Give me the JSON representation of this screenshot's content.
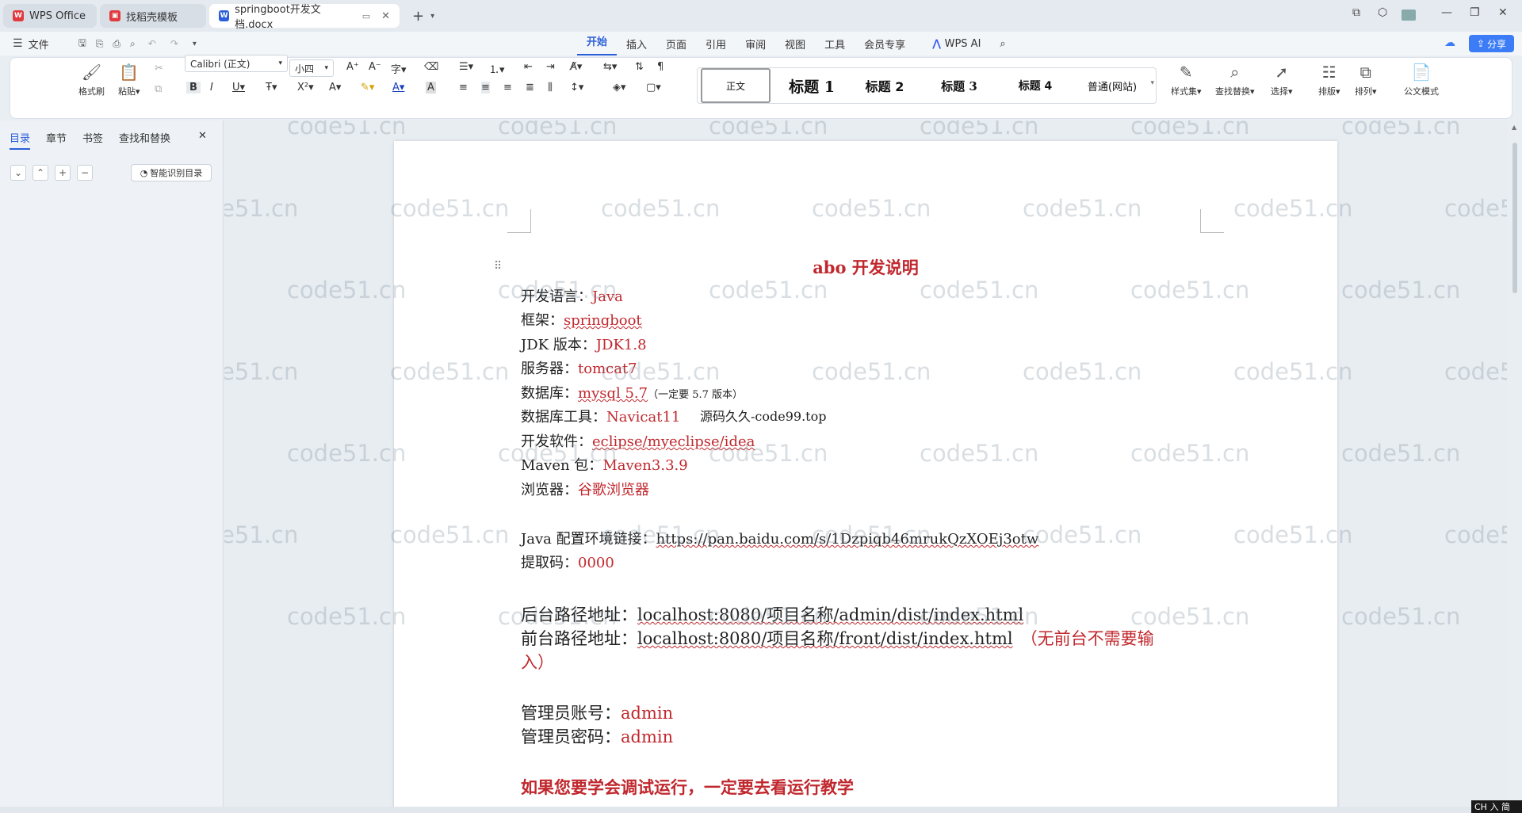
{
  "tabs": [
    {
      "label": "WPS Office"
    },
    {
      "label": "找稻壳模板"
    },
    {
      "label": "springboot开发文档.docx"
    }
  ],
  "menubar": {
    "file": "文件",
    "menus": [
      "开始",
      "插入",
      "页面",
      "引用",
      "审阅",
      "视图",
      "工具",
      "会员专享"
    ],
    "wps_ai": "WPS AI",
    "share": "分享"
  },
  "ribbon": {
    "format_painter": "格式刷",
    "paste": "粘贴",
    "font_name": "Calibri (正文)",
    "font_size": "小四",
    "styles": [
      "正文",
      "标题 1",
      "标题 2",
      "标题 3",
      "标题 4",
      "普通(网站)"
    ],
    "style_set": "样式集",
    "find_replace": "查找替换",
    "select": "选择",
    "layout": "排版",
    "arrange": "排列",
    "official_mode": "公文模式"
  },
  "sidebar": {
    "tabs": [
      "目录",
      "章节",
      "书签",
      "查找和替换"
    ],
    "smart_toc": "智能识别目录"
  },
  "doc": {
    "title": "abo 开发说明",
    "lines": [
      {
        "label": "开发语言：",
        "value": "Java"
      },
      {
        "label": "框架：",
        "value": "springboot"
      },
      {
        "label": "JDK 版本：",
        "value": "JDK1.8"
      },
      {
        "label": "服务器：",
        "value": "tomcat7"
      },
      {
        "label": "数据库：",
        "value": "mysql 5.7",
        "note": "（一定要 5.7 版本）"
      },
      {
        "label": "数据库工具：",
        "value": "Navicat11",
        "overlay": "源码久久-code99.top"
      },
      {
        "label": "开发软件：",
        "value": "eclipse/myeclipse/idea"
      },
      {
        "label": "Maven 包：",
        "value": "Maven3.3.9"
      },
      {
        "label": "浏览器：",
        "value": "谷歌浏览器"
      }
    ],
    "java_env_label": "Java 配置环境链接：",
    "java_env_url": "https://pan.baidu.com/s/1Dzpiqb46mrukQzXOEj3otw",
    "code_label": "提取码：",
    "code_value": "0000",
    "admin_path_label": "后台路径地址：",
    "admin_path": "localhost:8080/项目名称/admin/dist/index.html",
    "front_path_label": "前台路径地址：",
    "front_path": "localhost:8080/项目名称/front/dist/index.html",
    "front_note_1": "（无前台不需要输",
    "front_note_2": "入）",
    "admin_user_label": "管理员账号：",
    "admin_user": "admin",
    "admin_pwd_label": "管理员密码：",
    "admin_pwd": "admin",
    "tutorial": "如果您要学会调试运行，一定要去看运行教学"
  },
  "watermark": "code51.cn",
  "status": {
    "ime": "CH 入 简"
  }
}
